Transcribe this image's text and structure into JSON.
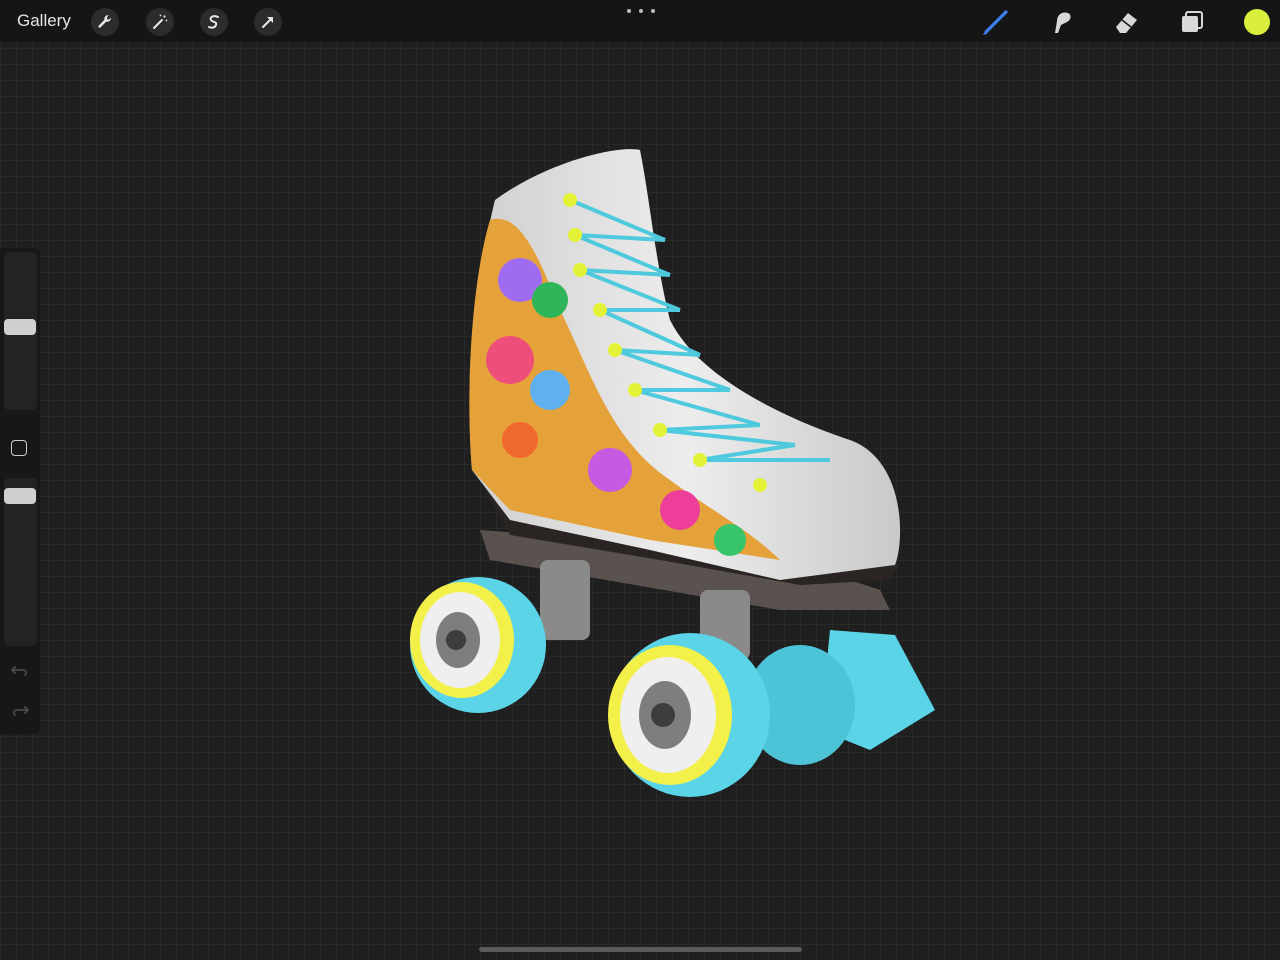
{
  "topbar": {
    "gallery_label": "Gallery",
    "left_tools": [
      "wrench-icon",
      "magic-wand-icon",
      "selection-icon",
      "transform-icon"
    ],
    "right_tools": [
      "brush-icon",
      "smudge-icon",
      "eraser-icon",
      "layers-icon"
    ],
    "active_tool": "brush-icon",
    "accent_color": "#3d7ff2",
    "current_color": "#d9ef3c"
  },
  "sidebar": {
    "size_slider_value": 0.33,
    "opacity_slider_value": 0.12,
    "controls": [
      "brush-size-slider",
      "modify-button",
      "opacity-slider",
      "undo-icon",
      "redo-icon"
    ]
  },
  "canvas": {
    "subject": "roller-skate-model",
    "colors": {
      "wheel": "#5ad4e6",
      "lace": "#4fc9dd",
      "eyelet": "#e4f237",
      "boot": "#e7e7e7",
      "sole": "#2a2523"
    }
  }
}
